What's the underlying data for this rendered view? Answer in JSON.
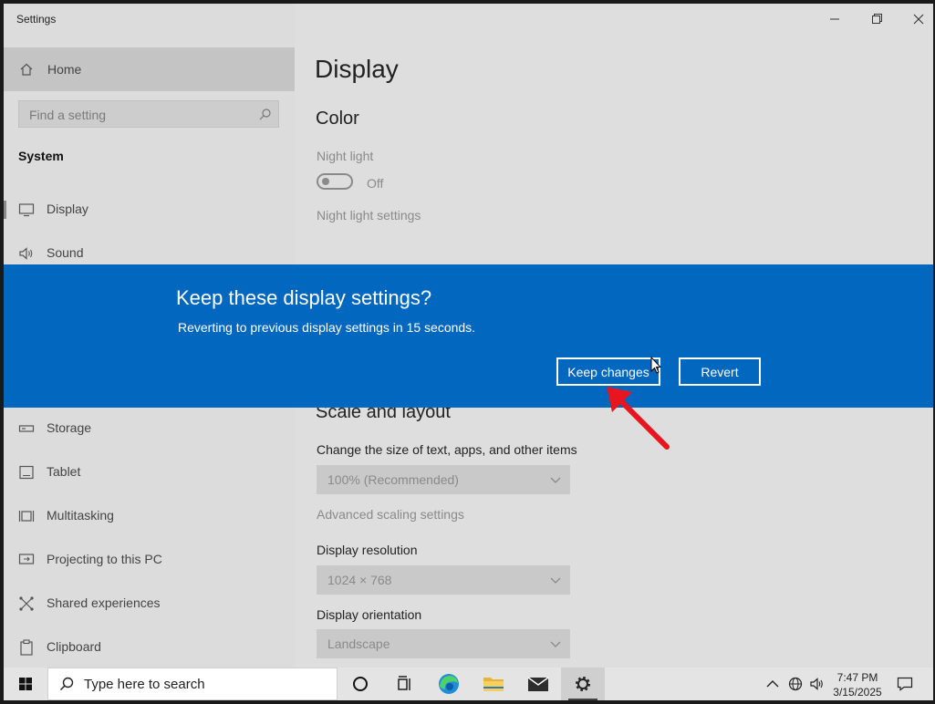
{
  "app_title": "Settings",
  "sidebar": {
    "home_label": "Home",
    "search_placeholder": "Find a setting",
    "section_title": "System",
    "items": [
      {
        "label": "Display",
        "icon": "monitor-icon"
      },
      {
        "label": "Sound",
        "icon": "speaker-icon"
      },
      {
        "label": "Storage",
        "icon": "storage-icon"
      },
      {
        "label": "Tablet",
        "icon": "tablet-icon"
      },
      {
        "label": "Multitasking",
        "icon": "multitasking-icon"
      },
      {
        "label": "Projecting to this PC",
        "icon": "projecting-icon"
      },
      {
        "label": "Shared experiences",
        "icon": "shared-experiences-icon"
      },
      {
        "label": "Clipboard",
        "icon": "clipboard-icon"
      }
    ]
  },
  "main": {
    "page_title": "Display",
    "color_heading": "Color",
    "night_light_label": "Night light",
    "night_light_state": "Off",
    "night_light_settings_link": "Night light settings",
    "scale_heading": "Scale and layout",
    "scale_label": "Change the size of text, apps, and other items",
    "scale_value": "100% (Recommended)",
    "advanced_scaling_link": "Advanced scaling settings",
    "resolution_label": "Display resolution",
    "resolution_value": "1024 × 768",
    "orientation_label": "Display orientation",
    "orientation_value": "Landscape"
  },
  "dialog": {
    "title": "Keep these display settings?",
    "message": "Reverting to previous display settings in 15 seconds.",
    "keep_label": "Keep changes",
    "revert_label": "Revert"
  },
  "taskbar": {
    "search_text": "Type here to search",
    "time": "7:47 PM",
    "date": "3/15/2025"
  },
  "colors": {
    "dialog_blue": "#0167bf",
    "annotation_arrow": "#e8141e"
  }
}
